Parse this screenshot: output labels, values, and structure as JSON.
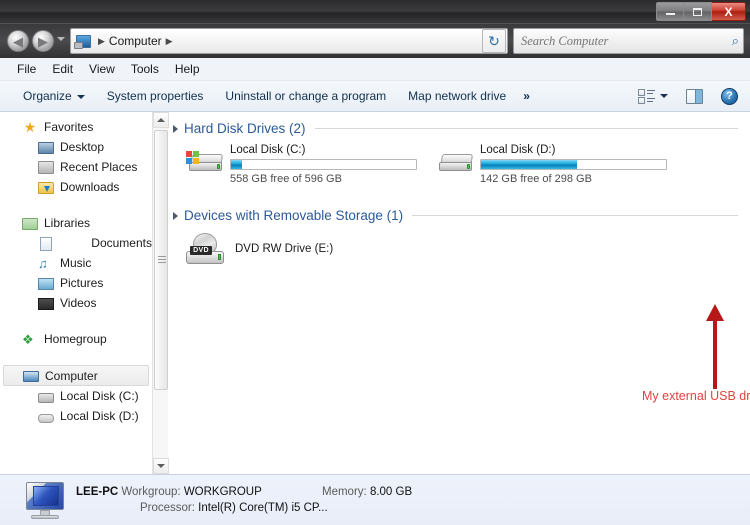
{
  "window": {
    "minimize_label": "Minimize",
    "maximize_label": "Maximize",
    "close_label": "X"
  },
  "addressbar": {
    "back_glyph": "◀",
    "forward_glyph": "▶",
    "crumb": "Computer",
    "separator": "▶",
    "refresh_glyph": "↻"
  },
  "search": {
    "placeholder": "Search Computer",
    "value": "",
    "icon_glyph": "⌕"
  },
  "menubar": {
    "items": [
      {
        "label": "File"
      },
      {
        "label": "Edit"
      },
      {
        "label": "View"
      },
      {
        "label": "Tools"
      },
      {
        "label": "Help"
      }
    ]
  },
  "toolbar": {
    "organize_label": "Organize",
    "items": [
      {
        "label": "System properties"
      },
      {
        "label": "Uninstall or change a program"
      },
      {
        "label": "Map network drive"
      }
    ],
    "overflow_label": "»",
    "help_label": "?"
  },
  "sidebar": {
    "groups": [
      {
        "header": {
          "label": "Favorites",
          "icon": "star-icon"
        },
        "items": [
          {
            "label": "Desktop",
            "icon": "desktop-icon"
          },
          {
            "label": "Recent Places",
            "icon": "recent-places-icon"
          },
          {
            "label": "Downloads",
            "icon": "downloads-icon"
          }
        ]
      },
      {
        "header": {
          "label": "Libraries",
          "icon": "libraries-icon"
        },
        "items": [
          {
            "label": "Documents",
            "icon": "documents-icon"
          },
          {
            "label": "Music",
            "icon": "music-icon"
          },
          {
            "label": "Pictures",
            "icon": "pictures-icon"
          },
          {
            "label": "Videos",
            "icon": "videos-icon"
          }
        ]
      },
      {
        "header": {
          "label": "Homegroup",
          "icon": "homegroup-icon"
        },
        "items": []
      },
      {
        "header": {
          "label": "Computer",
          "icon": "computer-icon",
          "selected": true
        },
        "items": [
          {
            "label": "Local Disk (C:)",
            "icon": "hdd-c-icon"
          },
          {
            "label": "Local Disk (D:)",
            "icon": "hdd-d-icon"
          }
        ]
      }
    ]
  },
  "content": {
    "groups": [
      {
        "title": "Hard Disk Drives (2)",
        "drives": [
          {
            "name": "Local Disk (C:)",
            "capacity_text": "558 GB free of 596 GB",
            "free_gb": 558,
            "total_gb": 596,
            "used_percent": 6,
            "icon": "system-hdd-icon"
          },
          {
            "name": "Local Disk (D:)",
            "capacity_text": "142 GB free of 298 GB",
            "free_gb": 142,
            "total_gb": 298,
            "used_percent": 52,
            "icon": "hdd-icon"
          }
        ]
      },
      {
        "title": "Devices with Removable Storage (1)",
        "devices": [
          {
            "name": "DVD RW Drive (E:)",
            "icon": "dvd-drive-icon",
            "badge": "DVD"
          }
        ]
      }
    ],
    "annotation": {
      "text": "My external USB drive",
      "color": "#e1433f",
      "arrow_color": "#b61818"
    }
  },
  "statusbar": {
    "computer_name": "LEE-PC",
    "workgroup_key": "Workgroup:",
    "workgroup_value": "WORKGROUP",
    "processor_key": "Processor:",
    "processor_value": "Intel(R) Core(TM) i5 CP...",
    "memory_key": "Memory:",
    "memory_value": "8.00 GB"
  },
  "colors": {
    "accent_blue": "#2b5a9b",
    "bar_fill": "#19a6dd",
    "annotation_red": "#e1433f"
  }
}
